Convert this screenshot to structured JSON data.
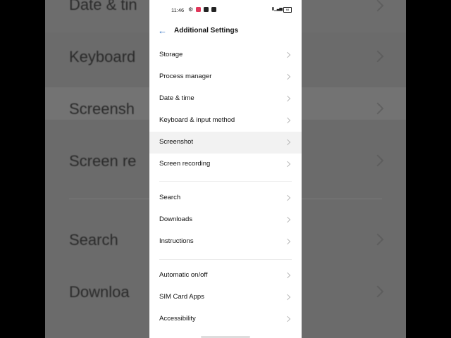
{
  "status_bar": {
    "time": "11:46",
    "battery": "68"
  },
  "header": {
    "title": "Additional Settings",
    "back_icon": "arrow-left-icon"
  },
  "accent_color": "#3a76c4",
  "groups": [
    {
      "items": [
        "Storage",
        "Process manager",
        "Date & time",
        "Keyboard & input method",
        "Screenshot",
        "Screen recording"
      ]
    },
    {
      "items": [
        "Search",
        "Downloads",
        "Instructions"
      ]
    },
    {
      "items": [
        "Automatic on/off",
        "SIM Card Apps",
        "Accessibility"
      ]
    }
  ],
  "background": {
    "rows": [
      "Date & tin",
      "Keyboard",
      "Screensh",
      "Screen re",
      "Search",
      "Downloa"
    ]
  }
}
